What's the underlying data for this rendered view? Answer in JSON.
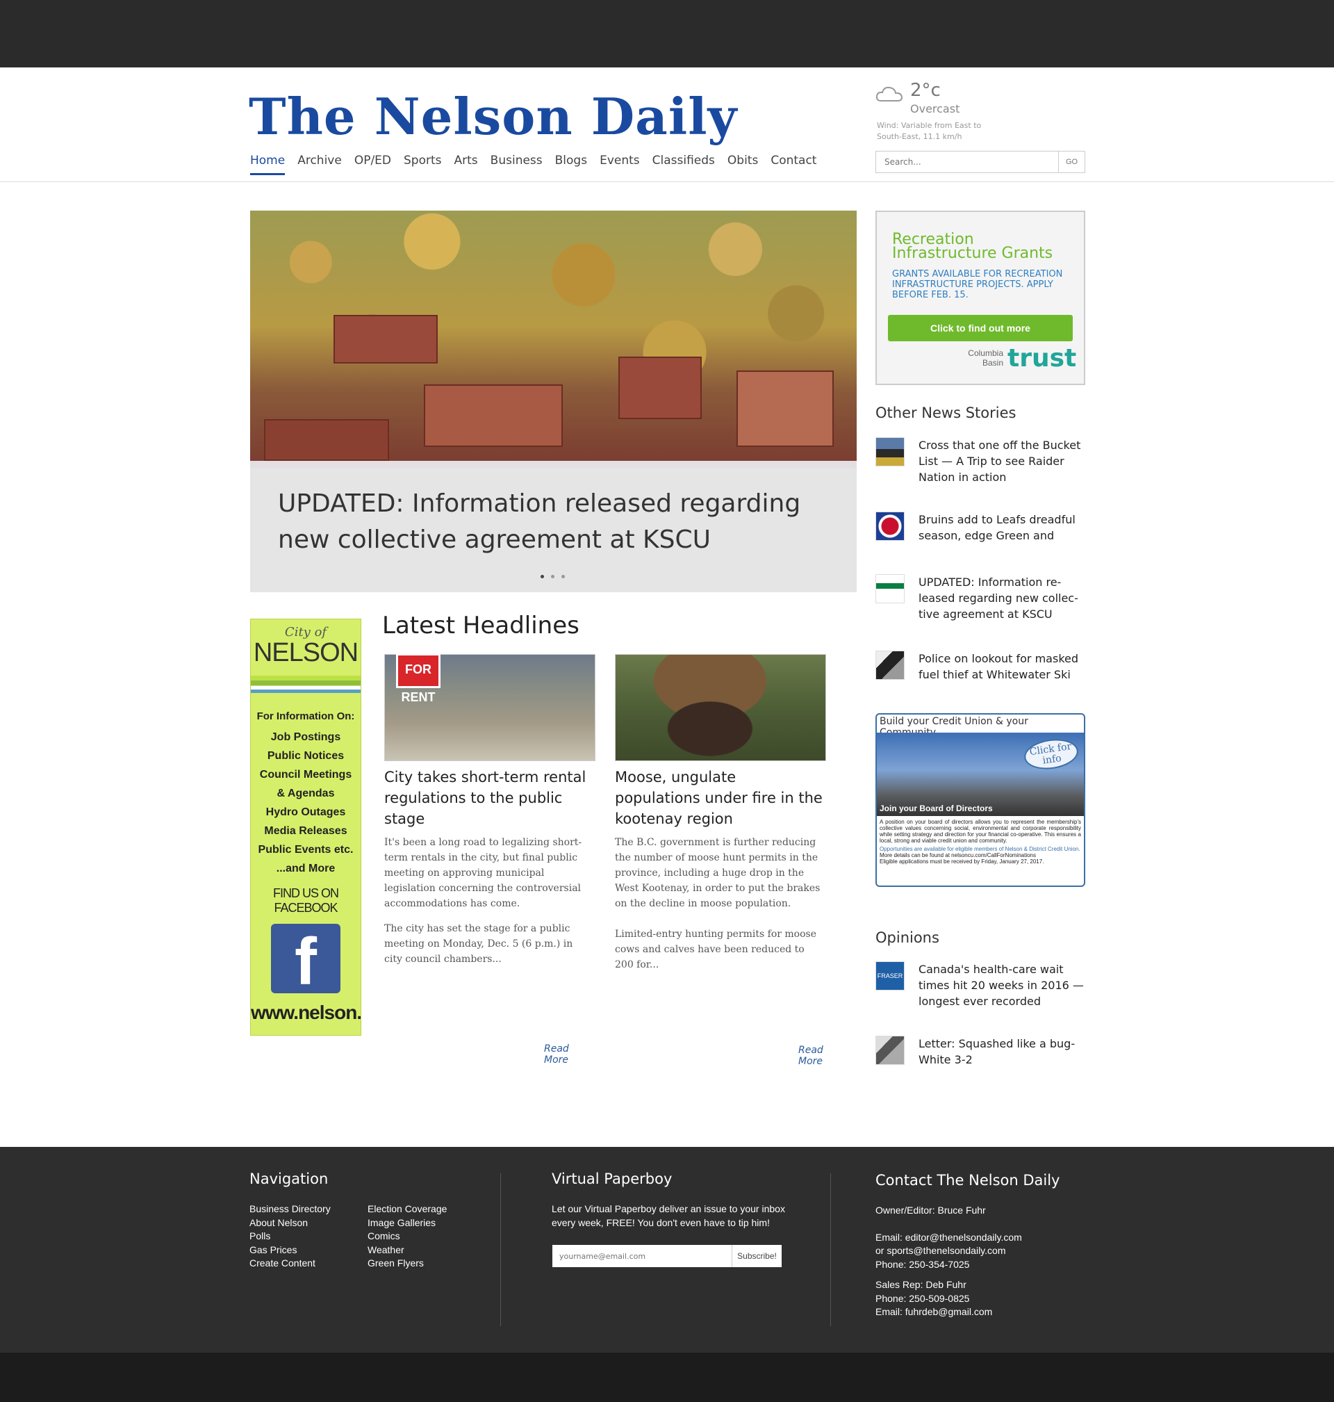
{
  "site": {
    "logo": "The Nelson Daily"
  },
  "nav": [
    "Home",
    "Archive",
    "OP/ED",
    "Sports",
    "Arts",
    "Business",
    "Blogs",
    "Events",
    "Classifieds",
    "Obits",
    "Contact"
  ],
  "weather": {
    "temp": "2°c",
    "condition": "Overcast",
    "wind": "Wind: Variable from East to South-East, 11.1 km/h",
    "icon": "cloud-icon"
  },
  "search": {
    "placeholder": "Search...",
    "go": "GO"
  },
  "hero": {
    "title": "UPDATED: Information released regarding new collective agreement at KSCU",
    "slides": 3,
    "active_slide": 1
  },
  "ad_recreation": {
    "title": "Recreation Infrastructure Grants",
    "text": "Grants available for recreation infrastructure projects. Apply before Feb. 15.",
    "button": "Click to find out more",
    "brand_small": "Columbia Basin",
    "brand": "trust"
  },
  "other_news": {
    "heading": "Other News Stories",
    "items": [
      "Cross that one off the Bucket List — A Trip to see Raider Nation in action",
      "Bruins add to Leafs dreadful season, edge Green and",
      "UPDATED: Information re-leased regarding new collec-tive agreement at KSCU",
      "Police on lookout for masked fuel thief at Whitewater Ski"
    ]
  },
  "ad_credit_union": {
    "header": "Build your Credit Union & your Community",
    "click": "Click for info",
    "join": "Join your Board of Directors",
    "body": "A position on your board of directors allows you to represent the membership's collective values concerning social, environmental and corporate responsibility while setting strategy and direction for your financial co-operative. This ensures a local, strong and viable credit union and community.",
    "note1": "Opportunities are available for eligible members of Nelson & District Credit Union.",
    "note2": "More details can be found at nelsoncu.com/CallForNominations",
    "note3": "Eligible applications must be received by Friday, January 27, 2017."
  },
  "opinions": {
    "heading": "Opinions",
    "items": [
      "Canada's health-care wait times hit 20 weeks in 2016 — longest ever recorded",
      "Letter: Squashed like a bug-White 3-2"
    ]
  },
  "ad_city": {
    "city": "City of",
    "name": "NELSON",
    "info_heading": "For Information On:",
    "items": [
      "Job Postings",
      "Public Notices",
      "Council Meetings",
      "& Agendas",
      "Hydro Outages",
      "Media Releases",
      "Public Events etc.",
      "...and More"
    ],
    "facebook": "FIND US ON FACEBOOK",
    "url": "www.nelson.ca"
  },
  "headlines": {
    "heading": "Latest Headlines",
    "articles": [
      {
        "title": "City takes short-term rental regulations to the public stage",
        "p1": "It's been a long road to legalizing short-term rentals in the city, but final public meeting on approving municipal legislation concerning the controversial accommodations has come.",
        "p2": "The city has set the stage for a public meeting on Monday, Dec. 5 (6 p.m.) in city council chambers...",
        "more": "Read More",
        "img_label": "FOR RENT"
      },
      {
        "title": "Moose, ungulate populations under fire in the kootenay region",
        "p1": "The B.C. government is further reducing the number of moose hunt permits in the province, including a huge drop in the West Kootenay, in order to put the brakes on the decline in moose population.",
        "p2": "Limited-entry hunting permits for moose cows and calves have been reduced to 200 for...",
        "more": "Read More"
      }
    ]
  },
  "footer": {
    "nav_heading": "Navigation",
    "nav_col1": [
      "Business Directory",
      "About Nelson",
      "Polls",
      "Gas Prices",
      "Create Content"
    ],
    "nav_col2": [
      "Election Coverage",
      "Image Galleries",
      "Comics",
      "Weather",
      "Green Flyers"
    ],
    "paperboy_heading": "Virtual Paperboy",
    "paperboy_text": "Let our Virtual Paperboy deliver an issue to your inbox every week, FREE! You don't even have to tip him!",
    "email_placeholder": "yourname@email.com",
    "subscribe": "Subscribe!",
    "contact_heading": "Contact The Nelson Daily",
    "owner": "Owner/Editor: Bruce Fuhr",
    "email1": "Email: editor@thenelsondaily.com",
    "email2": "or sports@thenelsondaily.com",
    "phone1": "Phone: 250-354-7025",
    "sales": "Sales Rep: Deb Fuhr",
    "phone2": "Phone: 250-509-0825",
    "email3": "Email: fuhrdeb@gmail.com"
  }
}
